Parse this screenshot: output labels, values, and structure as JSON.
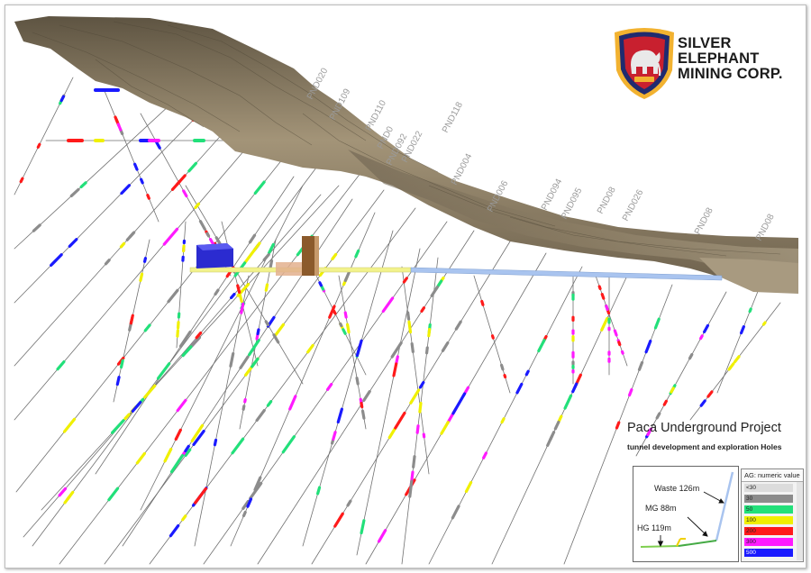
{
  "logo": {
    "line1": "SILVER",
    "line2": "ELEPHANT",
    "line3": "MINING CORP.",
    "colors": {
      "shield_outer": "#f2b230",
      "shield_inner": "#1f2b6f",
      "field": "#c8202f",
      "elephant": "#e9e9e9"
    }
  },
  "title": "Paca Underground Project",
  "subtitle": "tunnel development and exploration Holes",
  "hole_labels": [
    "PND020",
    "PND109",
    "PND110",
    "PND0",
    "PND092",
    "PND022",
    "PND118",
    "PND004",
    "PND006",
    "PND094",
    "PND095",
    "PND08",
    "PND026",
    "PND08",
    "PND08"
  ],
  "inset": {
    "waste": "Waste 126m",
    "mg": "MG  88m",
    "hg": "HG  119m"
  },
  "legend": {
    "title": "AG: numeric value",
    "classes": [
      {
        "label": "<30",
        "color": "#dcdcdc"
      },
      {
        "label": "30",
        "color": "#8c8c8c"
      },
      {
        "label": "50",
        "color": "#22e07a"
      },
      {
        "label": "100",
        "color": "#f0f000"
      },
      {
        "label": "200",
        "color": "#ff1a1a"
      },
      {
        "label": "300",
        "color": "#ff1aff"
      },
      {
        "label": "500",
        "color": "#1a1aff"
      }
    ]
  },
  "colors": {
    "terrain": "#8b7d64",
    "tunnel_yellow": "#f2f28c",
    "tunnel_blue": "#a9c4ef",
    "hole_line": "#6f6f6f",
    "block_blue": "#2b2bd0",
    "block_brown": "#8b5a2b"
  }
}
